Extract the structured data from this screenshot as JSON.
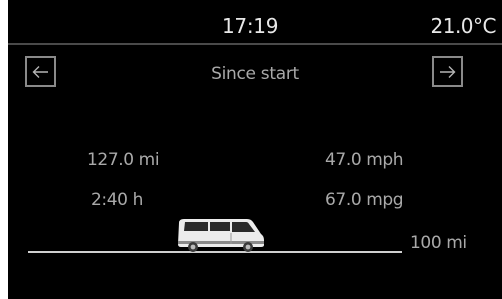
{
  "status": {
    "time": "17:19",
    "temperature": "21.0°C"
  },
  "header": {
    "title": "Since start"
  },
  "stats": {
    "distance": "127.0 mi",
    "speed": "47.0 mph",
    "duration": "2:40 h",
    "consumption": "67.0 mpg"
  },
  "range": {
    "label": "100 mi"
  },
  "icons": {
    "back": "arrow-left-icon",
    "forward": "arrow-right-icon",
    "vehicle": "van-icon"
  }
}
